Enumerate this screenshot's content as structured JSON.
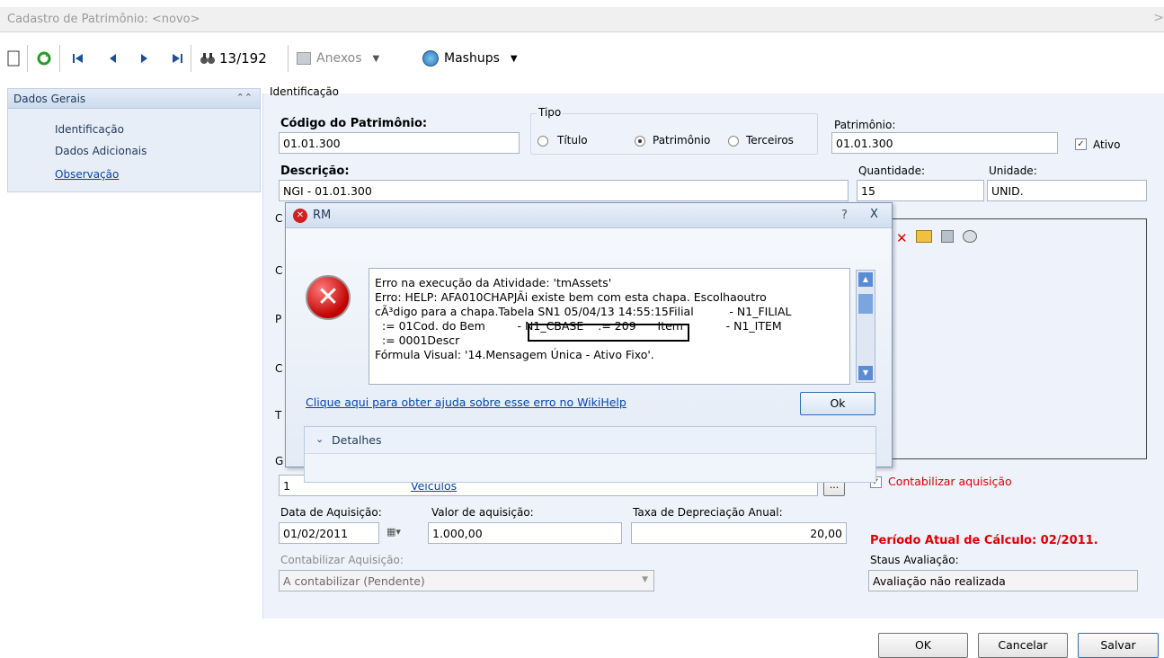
{
  "window": {
    "title": "Cadastro de Patrimônio: <novo>",
    "close": ">"
  },
  "toolbar": {
    "record_counter": "13/192",
    "anexos_label": "Anexos",
    "mashups_label": "Mashups"
  },
  "sidebar": {
    "header": "Dados Gerais",
    "items": [
      {
        "label": "Identificação"
      },
      {
        "label": "Dados Adicionais"
      },
      {
        "label": "Observação"
      }
    ]
  },
  "form": {
    "section_title": "Identificação",
    "codigo_label": "Código do Patrimônio:",
    "codigo_value": "01.01.300",
    "tipo_label": "Tipo",
    "tipo_options": [
      {
        "label": "Título",
        "selected": false
      },
      {
        "label": "Patrimônio",
        "selected": true
      },
      {
        "label": "Terceiros",
        "selected": false
      }
    ],
    "patrimonio_label": "Patrimônio:",
    "patrimonio_value": "01.01.300",
    "ativo_label": "Ativo",
    "descricao_label": "Descrição:",
    "descricao_value": "NGI - 01.01.300",
    "quantidade_label": "Quantidade:",
    "quantidade_value": "15",
    "unidade_label": "Unidade:",
    "unidade_value": "UNID.",
    "grupo_code": "1",
    "grupo_link": "Veículos",
    "contabilizar_chk_label": "Contabilizar aquisição",
    "data_aquisicao_label": "Data de Aquisição:",
    "data_aquisicao_value": "01/02/2011",
    "valor_aquisicao_label": "Valor de aquisição:",
    "valor_aquisicao_value": "1.000,00",
    "taxa_label": "Taxa de Depreciação Anual:",
    "taxa_value": "20,00",
    "periodo_text": "Período Atual de Cálculo: 02/2011.",
    "contabilizar_aquisicao_label": "Contabilizar Aquisição:",
    "contabilizar_aquisicao_value": "A contabilizar (Pendente)",
    "status_label": "Staus Avaliação:",
    "status_value": "Avaliação não realizada"
  },
  "buttons": {
    "ok": "OK",
    "cancel": "Cancelar",
    "save": "Salvar"
  },
  "dialog": {
    "title": "RM",
    "help_btn": "?",
    "close_btn": "X",
    "lines": [
      "Erro na execução da Atividade: 'tmAssets'",
      "Erro: HELP: AFA010CHAPJÃi existe bem com esta chapa. Escolhaoutro",
      "cÃ³digo para a chapa.Tabela SN1 05/04/13 14:55:15Filial          - N1_FILIAL",
      "  := 01Cod. do Bem         - N1_CBASE    := 209      Item            - N1_ITEM",
      "  := 0001Descr",
      "Fórmula Visual: '14.Mensagem Única - Ativo Fixo'."
    ],
    "wiki_link": "Clique aqui para obter ajuda sobre esse erro no WikiHelp",
    "ok_btn": "Ok",
    "details_label": "Detalhes"
  },
  "colors": {
    "accent": "#1e395b",
    "error": "#e00000",
    "link": "#0645ad"
  }
}
